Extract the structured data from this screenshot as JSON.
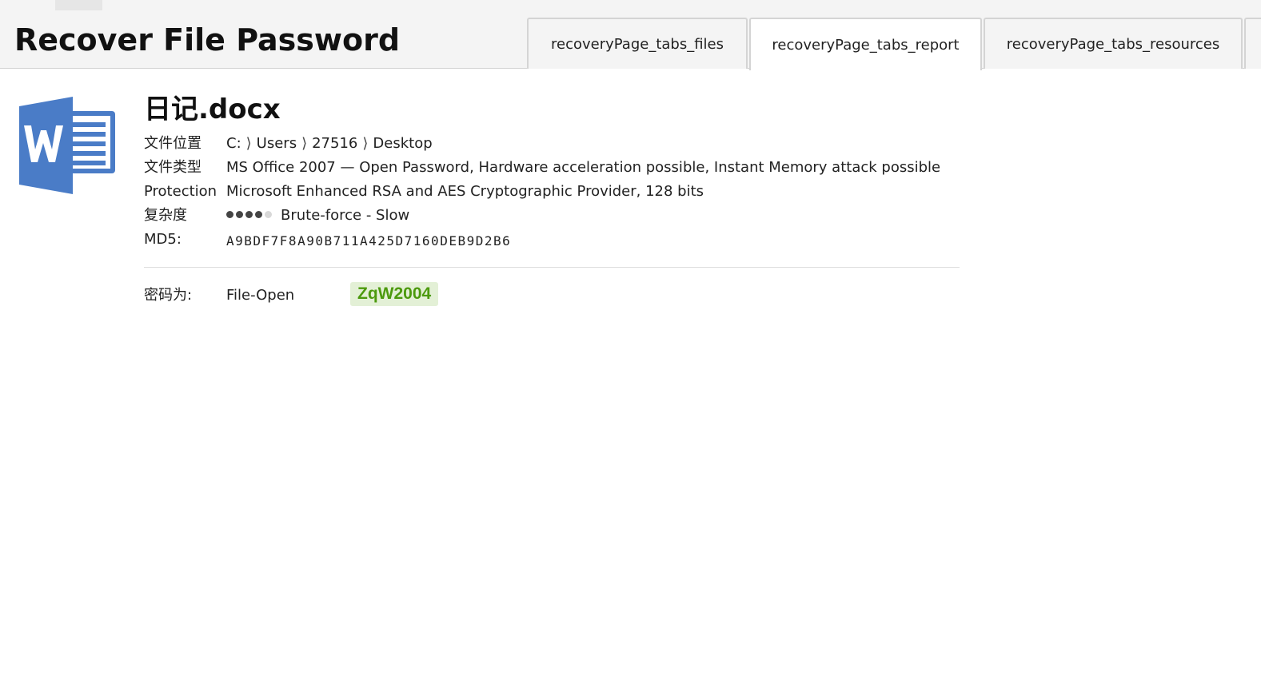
{
  "page_title": "Recover File Password",
  "tabs": [
    {
      "label": "recoveryPage_tabs_files"
    },
    {
      "label": "recoveryPage_tabs_report"
    },
    {
      "label": "recoveryPage_tabs_resources"
    }
  ],
  "file": {
    "name": "日记.docx",
    "icon": "word-document-icon",
    "location_label": "文件位置",
    "location_path": [
      "C:",
      "Users",
      "27516",
      "Desktop"
    ],
    "type_label": "文件类型",
    "type_value": "MS Office 2007 — Open Password, Hardware acceleration possible, Instant Memory attack possible",
    "protection_label": "Protection",
    "protection_value": "Microsoft Enhanced RSA and AES Cryptographic Provider, 128 bits",
    "complexity_label": "复杂度",
    "complexity_level": 4,
    "complexity_max": 5,
    "complexity_text": "Brute-force - Slow",
    "md5_label": "MD5:",
    "md5_value": "A9BDF7F8A90B711A425D7160DEB9D2B6"
  },
  "password": {
    "label": "密码为:",
    "kind": "File-Open",
    "value": "ZqW2004"
  },
  "colors": {
    "accent_word": "#4a7cc7",
    "password_text": "#4c9a0e",
    "password_bg": "#e3f0d6",
    "header_bg": "#f4f4f4"
  }
}
